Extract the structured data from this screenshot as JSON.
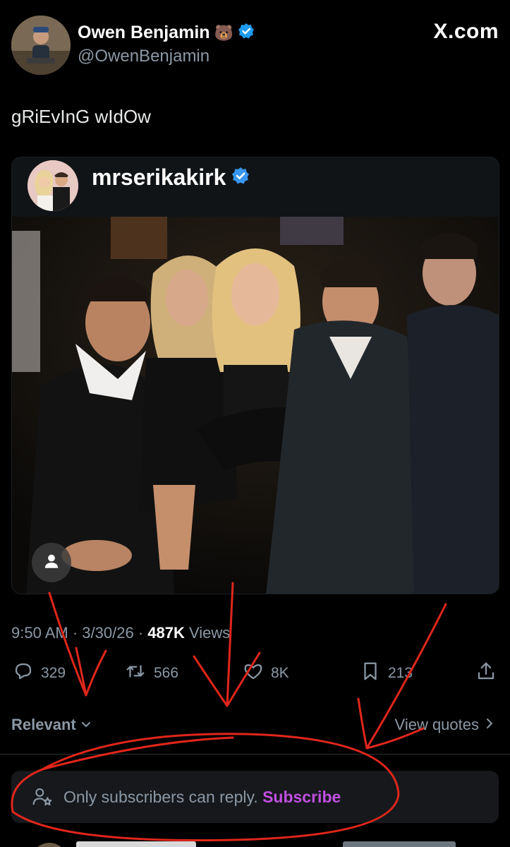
{
  "header": {
    "display_name": "Owen Benjamin",
    "emoji": "🐻",
    "handle": "@OwenBenjamin",
    "site_label": "X.com"
  },
  "tweet": {
    "text": "gRiEvInG wIdOw"
  },
  "embedded": {
    "username": "mrserikakirk"
  },
  "meta": {
    "time": "9:50 AM",
    "date": "3/30/26",
    "views_count": "487K",
    "views_label": "Views"
  },
  "actions": {
    "replies": "329",
    "reposts": "566",
    "likes": "8K",
    "bookmarks": "213"
  },
  "sort": {
    "relevant_label": "Relevant",
    "view_quotes_label": "View quotes"
  },
  "reply_restriction": {
    "text": "Only subscribers can reply.",
    "link_label": "Subscribe"
  },
  "colors": {
    "background": "#000000",
    "verified": "#1d9bf0",
    "subscribe_link": "#c04fe0",
    "annotation": "#e0261b"
  }
}
